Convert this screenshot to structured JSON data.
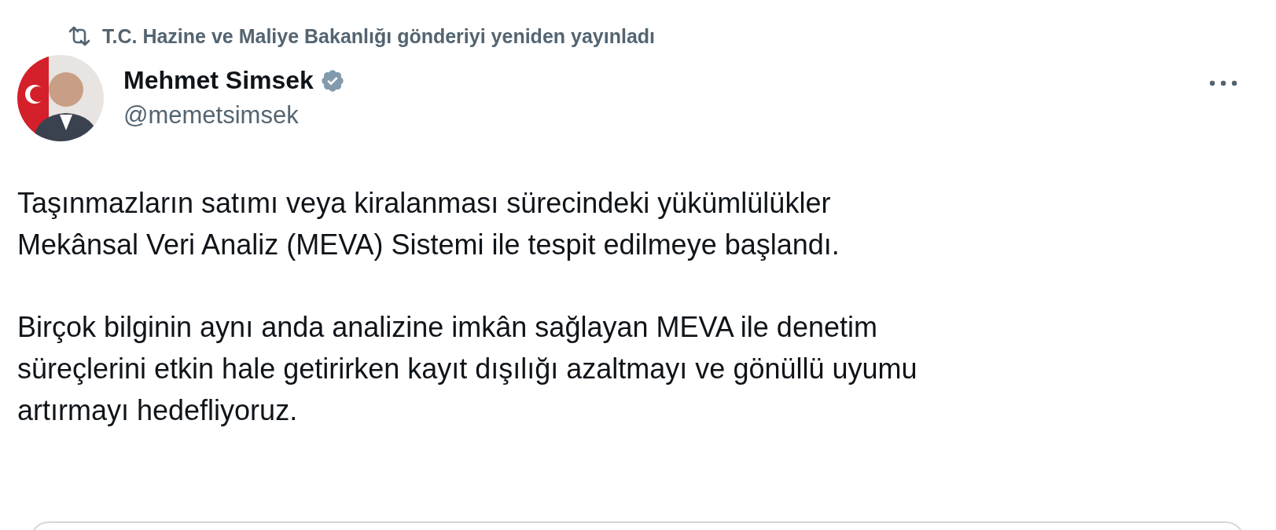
{
  "repost": {
    "label": "T.C. Hazine ve Maliye Bakanlığı gönderiyi yeniden yayınladı"
  },
  "author": {
    "name": "Mehmet Simsek",
    "verified": true,
    "handle": "@memetsimsek"
  },
  "body": [
    "Taşınmazların satımı veya kiralanması sürecindeki yükümlülükler\nMekânsal Veri Analiz (MEVA) Sistemi ile tespit edilmeye başlandı.",
    "Birçok bilginin aynı anda analizine imkân sağlayan MEVA ile denetim\nsüreçlerini etkin hale getirirken kayıt dışılığı azaltmayı ve gönüllü uyumu\nartırmayı hedefliyoruz."
  ]
}
